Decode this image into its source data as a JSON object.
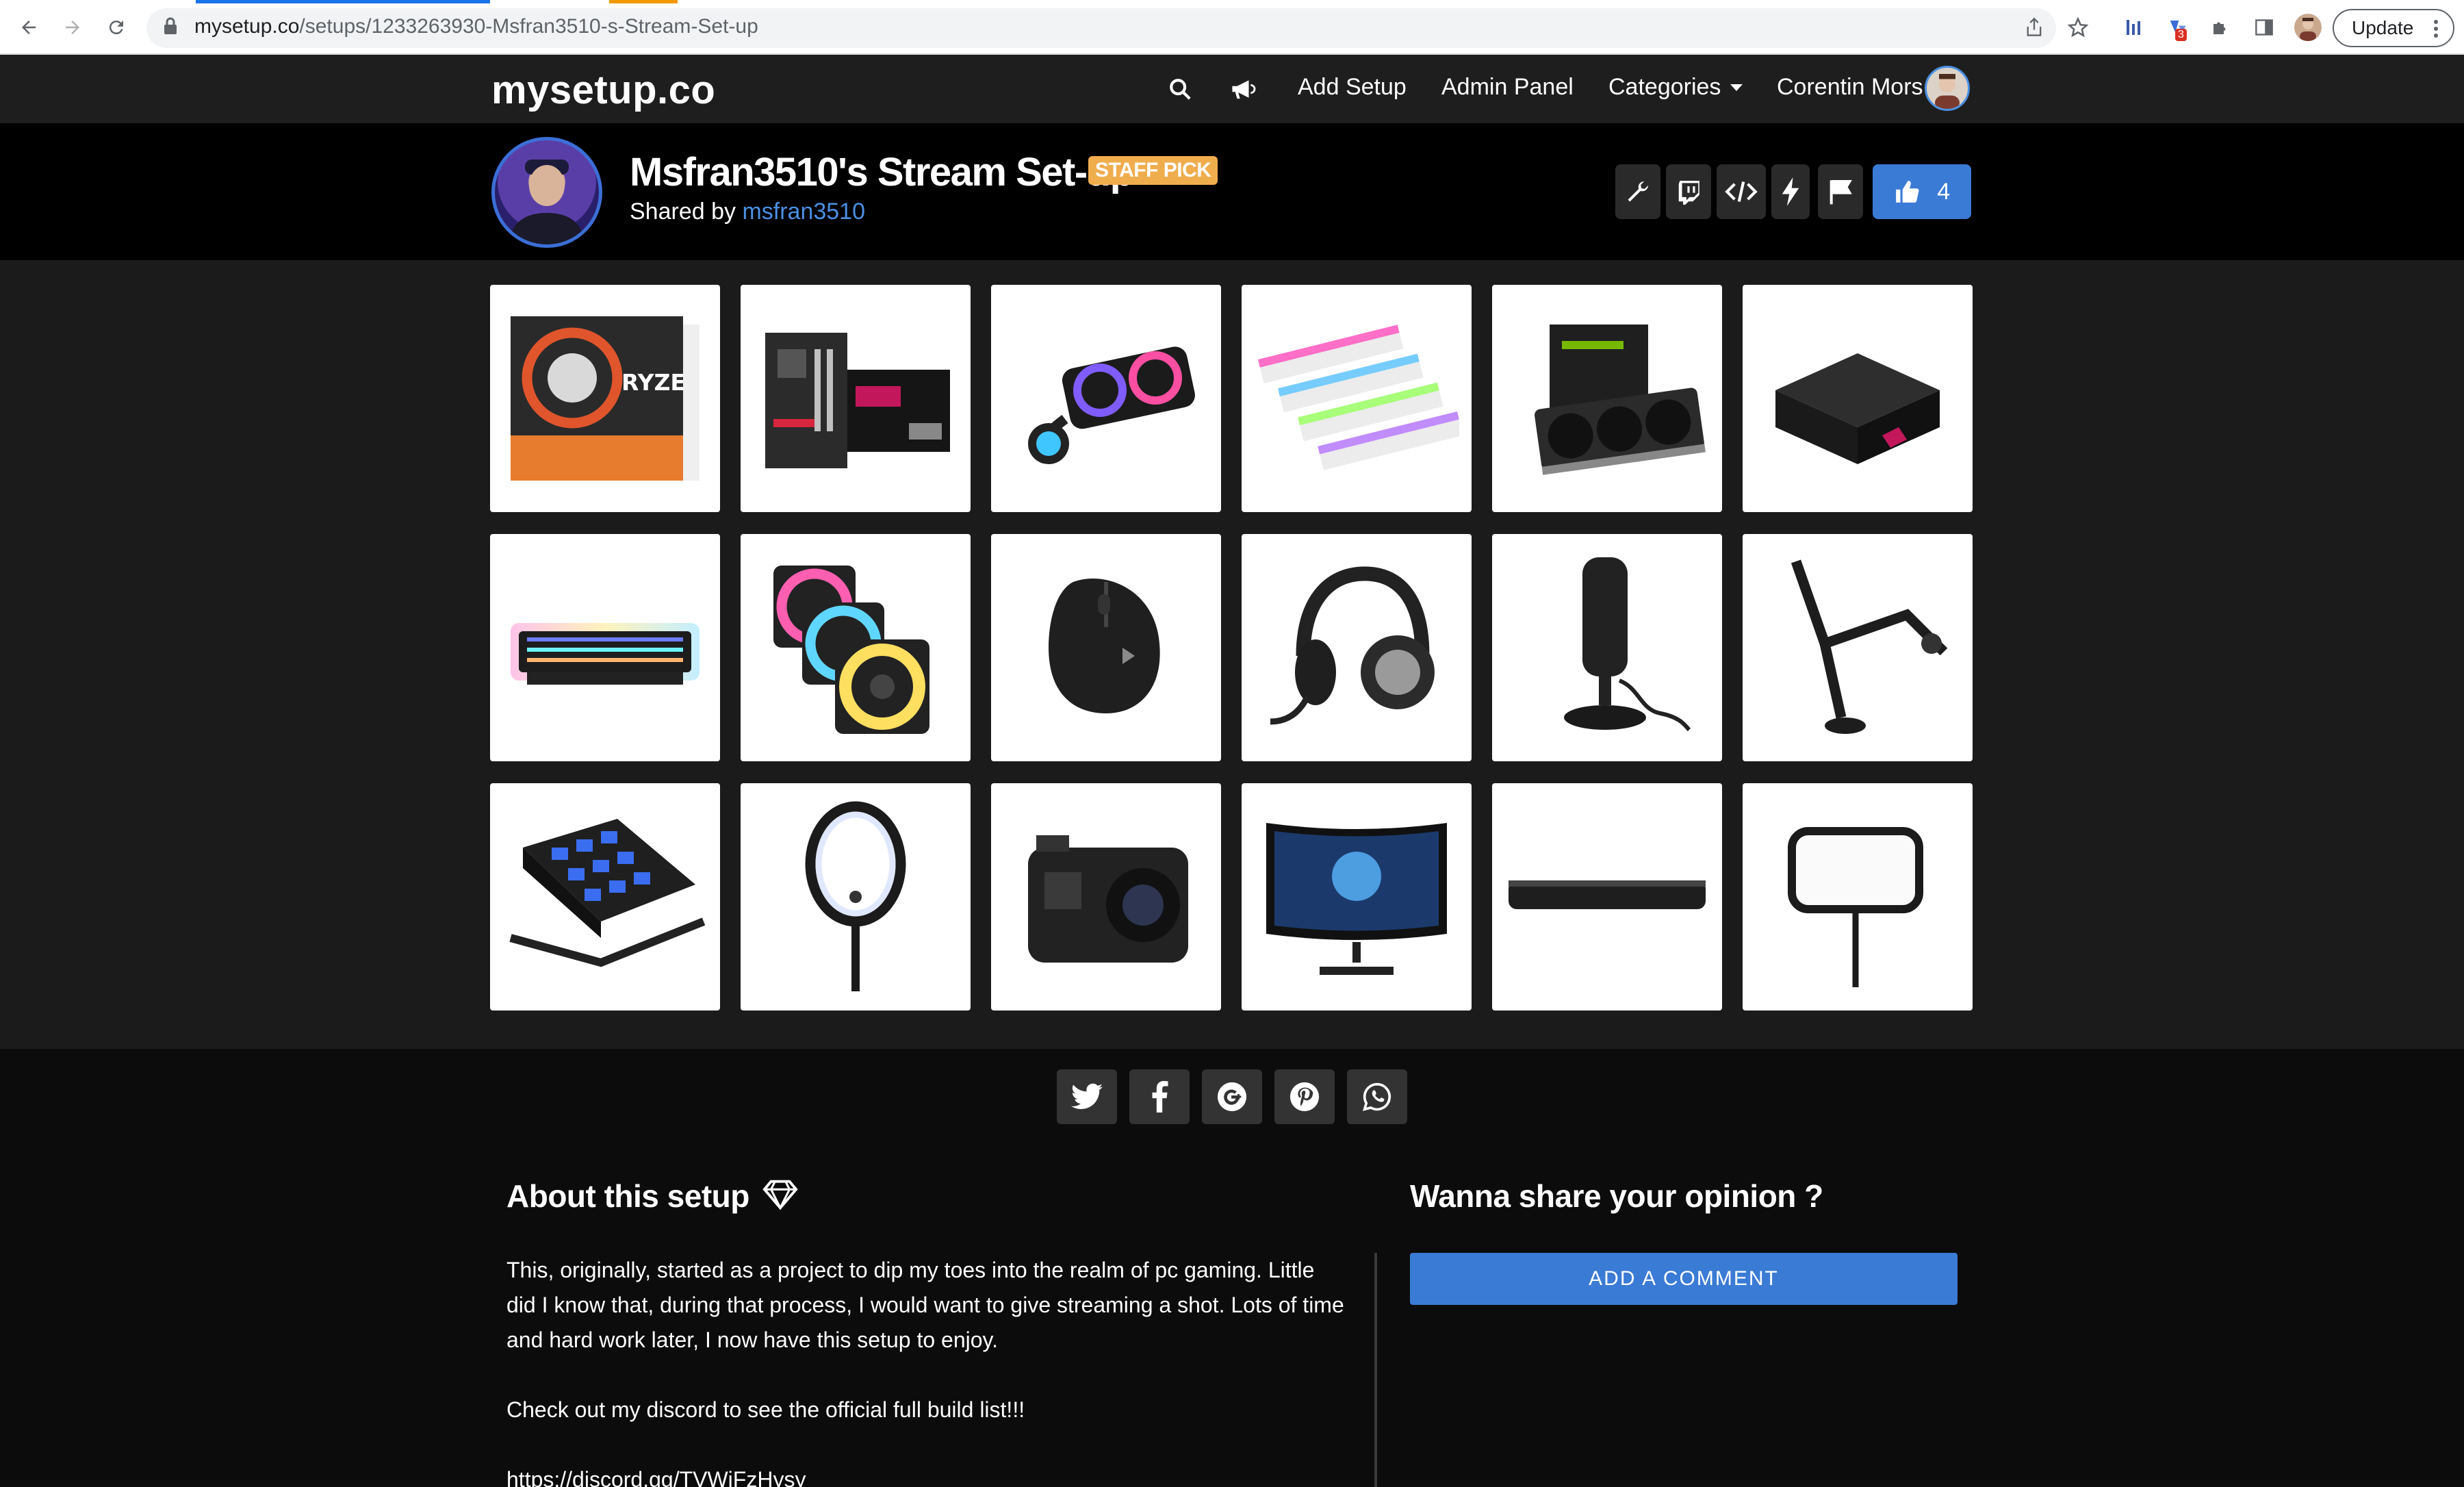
{
  "browser": {
    "url_host": "mysetup.co",
    "url_path": "/setups/1233263930-Msfran3510-s-Stream-Set-up",
    "update_label": "Update",
    "extension_badge": "3"
  },
  "site": {
    "logo": "mysetup.co",
    "nav": {
      "add_setup": "Add Setup",
      "admin_panel": "Admin Panel",
      "categories": "Categories",
      "user_name": "Corentin Mors"
    }
  },
  "setup": {
    "title": "Msfran3510's Stream Set-up",
    "badge": "STAFF PICK",
    "shared_by_prefix": "Shared by",
    "author": "msfran3510",
    "likes": "4",
    "accent": "#3a7bd5",
    "badge_color": "#f0ad4e"
  },
  "products": [
    {
      "name": "AMD Ryzen 9 CPU",
      "icon": "cpu-box"
    },
    {
      "name": "ROG Strix B550 motherboard",
      "icon": "motherboard"
    },
    {
      "name": "AIO liquid cooler",
      "icon": "cooler"
    },
    {
      "name": "RGB RAM kit",
      "icon": "ram"
    },
    {
      "name": "MSI RTX graphics card",
      "icon": "gpu"
    },
    {
      "name": "ROG power supply",
      "icon": "psu"
    },
    {
      "name": "RGB mechanical keyboard",
      "icon": "keyboard"
    },
    {
      "name": "RGB case fans",
      "icon": "fans"
    },
    {
      "name": "Gaming mouse",
      "icon": "mouse"
    },
    {
      "name": "Gaming headset",
      "icon": "headset"
    },
    {
      "name": "USB microphone",
      "icon": "microphone"
    },
    {
      "name": "Microphone boom arm",
      "icon": "boom-arm"
    },
    {
      "name": "Stream Deck",
      "icon": "stream-deck"
    },
    {
      "name": "Ring light",
      "icon": "ring-light"
    },
    {
      "name": "GoPro camera",
      "icon": "action-camera"
    },
    {
      "name": "Curved monitor",
      "icon": "monitor"
    },
    {
      "name": "Soundbar",
      "icon": "soundbar"
    },
    {
      "name": "Key light",
      "icon": "key-light"
    }
  ],
  "share": [
    "twitter-icon",
    "facebook-icon",
    "google-plus-icon",
    "pinterest-icon",
    "whatsapp-icon"
  ],
  "about": {
    "title": "About this setup",
    "paragraphs": [
      "This, originally, started as a project to dip my toes into the realm of pc gaming. Little did I know that, during that process, I would want to give streaming a shot. Lots of time and hard work later, I now have this setup to enjoy.",
      "Check out my discord to see the official full build list!!!",
      "https://discord.gg/TVWjFzHysy"
    ]
  },
  "opinion": {
    "title": "Wanna share your opinion ?",
    "button": "ADD A COMMENT"
  }
}
